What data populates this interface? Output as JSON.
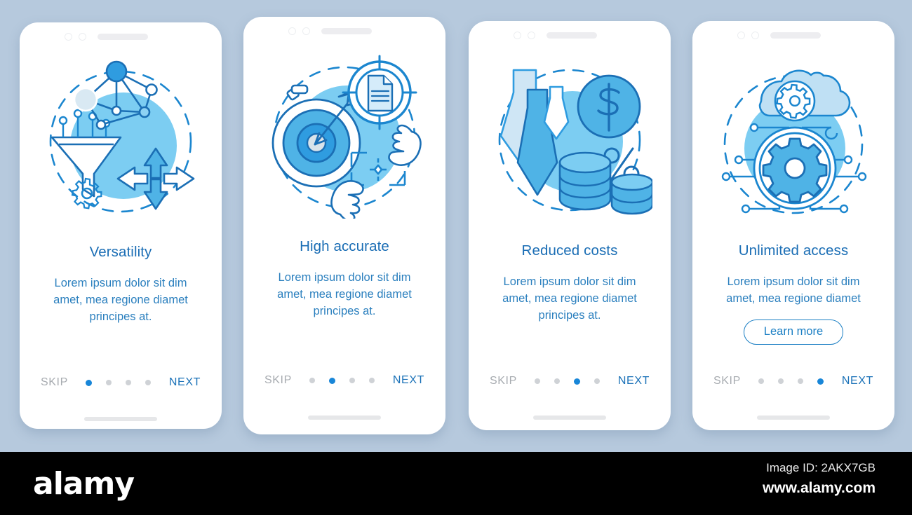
{
  "background_color": "#b6c9dd",
  "accent_color": "#1b7fc4",
  "screens": [
    {
      "id": "versatility",
      "title": "Versatility",
      "description": "Lorem ipsum dolor sit dim amet, mea regione diamet principes at.",
      "skip_label": "SKIP",
      "next_label": "NEXT",
      "cta_label": null,
      "active_dot": 0,
      "dot_count": 4,
      "illustration": "funnel-network-arrows-gear-icon"
    },
    {
      "id": "high-accurate",
      "title": "High accurate",
      "description": "Lorem ipsum dolor sit dim amet, mea regione diamet principes at.",
      "skip_label": "SKIP",
      "next_label": "NEXT",
      "cta_label": null,
      "active_dot": 1,
      "dot_count": 4,
      "illustration": "stopwatch-target-document-hands-icon"
    },
    {
      "id": "reduced-costs",
      "title": "Reduced costs",
      "description": "Lorem ipsum dolor sit dim amet, mea regione diamet principes at.",
      "skip_label": "SKIP",
      "next_label": "NEXT",
      "cta_label": null,
      "active_dot": 2,
      "dot_count": 4,
      "illustration": "down-arrows-dollar-coins-percent-icon"
    },
    {
      "id": "unlimited-access",
      "title": "Unlimited access",
      "description": "Lorem ipsum dolor sit dim amet, mea regione diamet",
      "skip_label": "SKIP",
      "next_label": "NEXT",
      "cta_label": "Learn more",
      "active_dot": 3,
      "dot_count": 4,
      "illustration": "cloud-gear-network-icon"
    }
  ],
  "watermark": {
    "logo": "alamy",
    "image_id": "Image ID: 2AKX7GB",
    "url": "www.alamy.com"
  }
}
